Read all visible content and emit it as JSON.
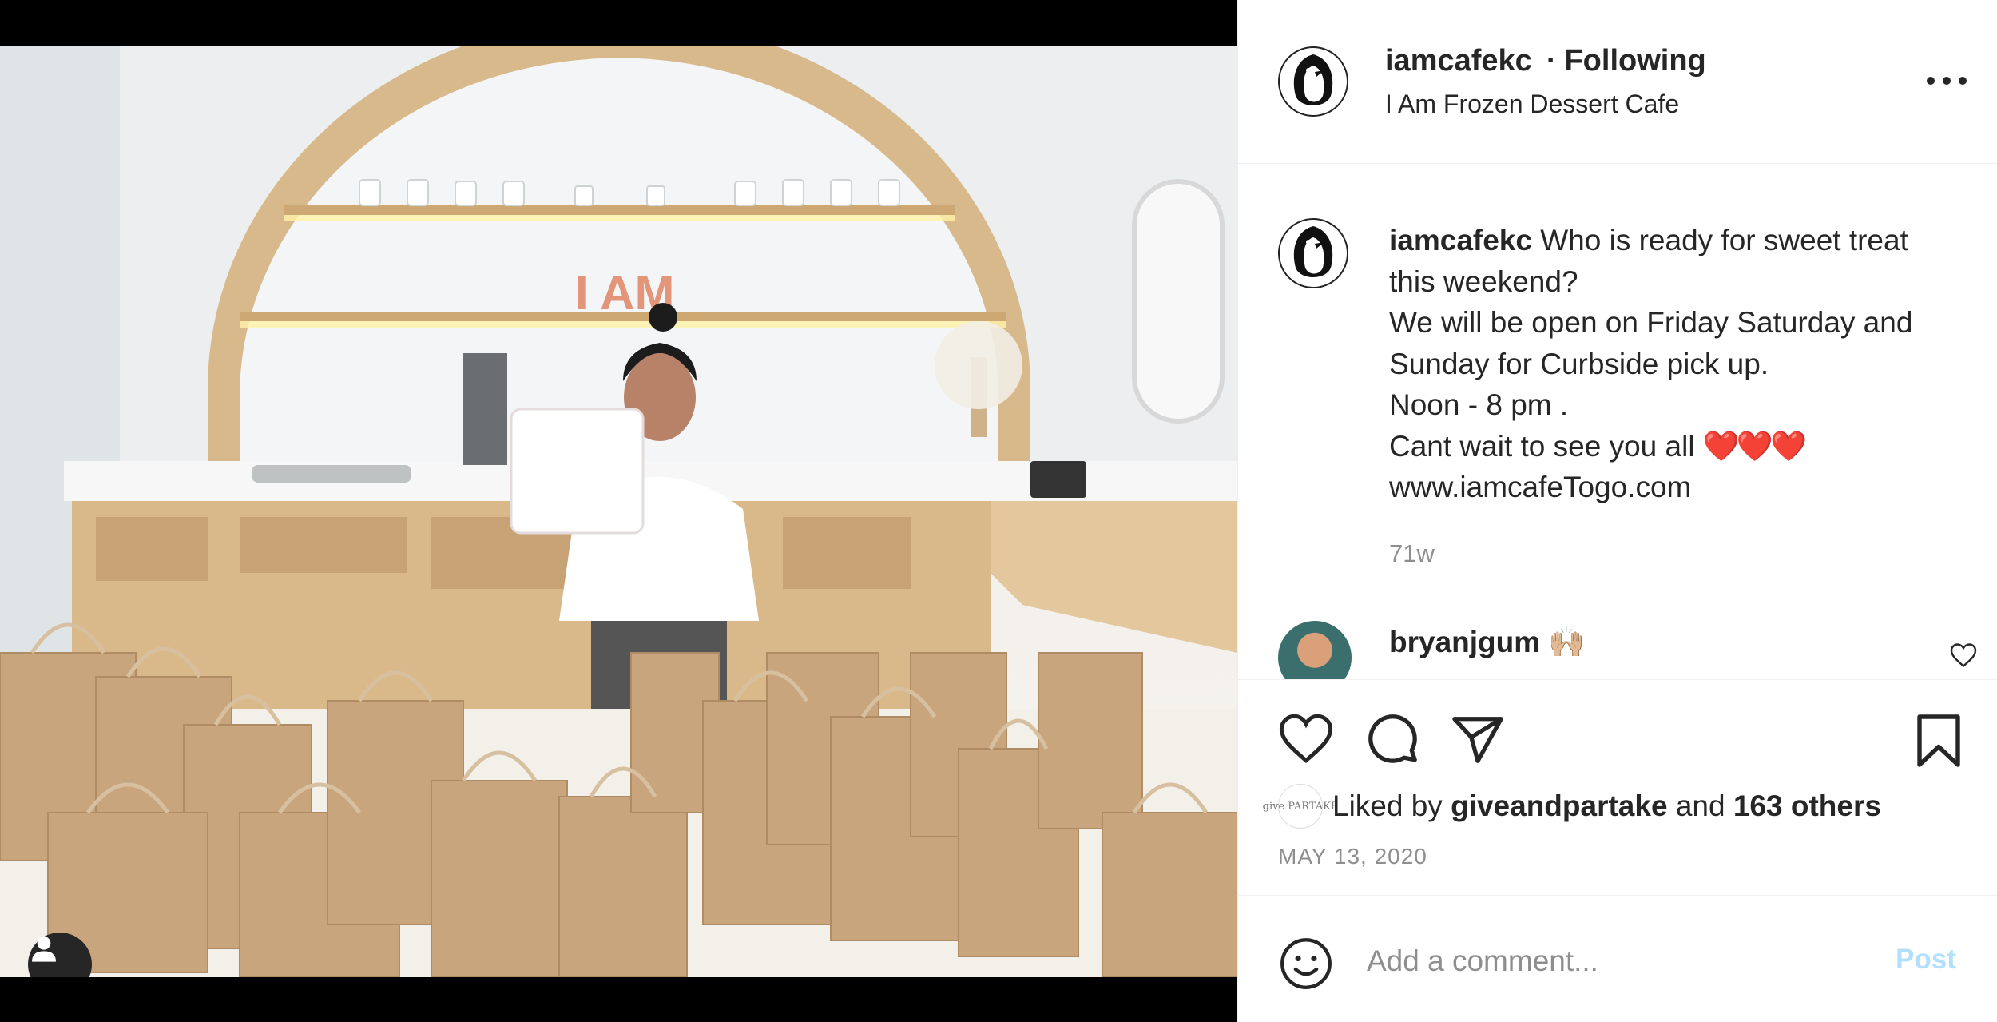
{
  "post": {
    "username": "iamcafekc",
    "follow_status": "Following",
    "location": "I Am Frozen Dessert Cafe",
    "caption_lines": [
      "Who is ready for sweet treat",
      "this weekend?",
      "We will be open on Friday Saturday and",
      "Sunday for Curbside pick up.",
      "Noon - 8 pm .",
      "Cant wait to see you all",
      "www.iamcafeTogo.com"
    ],
    "caption_hearts": "❤️❤️❤️",
    "age": "71w",
    "photo_sign_text": "I AM"
  },
  "comment": {
    "username": "bryanjgum",
    "text": "🙌🏼"
  },
  "likes": {
    "prefix": "Liked by",
    "by_user": "giveandpartake",
    "middle": "and",
    "others": "163 others",
    "avatar_text": "give PARTAKE"
  },
  "date": "MAY 13, 2020",
  "add_comment": {
    "placeholder": "Add a comment...",
    "post_label": "Post"
  },
  "icons": {
    "like": "heart-icon",
    "comment": "comment-icon",
    "share": "paper-plane-icon",
    "save": "bookmark-icon",
    "emoji": "smile-icon",
    "more": "more-options-icon",
    "user_tag": "user-tag-icon"
  },
  "colors": {
    "text": "#262626",
    "secondary": "#8e8e8e",
    "post_button_disabled": "#b2dffc",
    "heart": "#e0101f"
  }
}
